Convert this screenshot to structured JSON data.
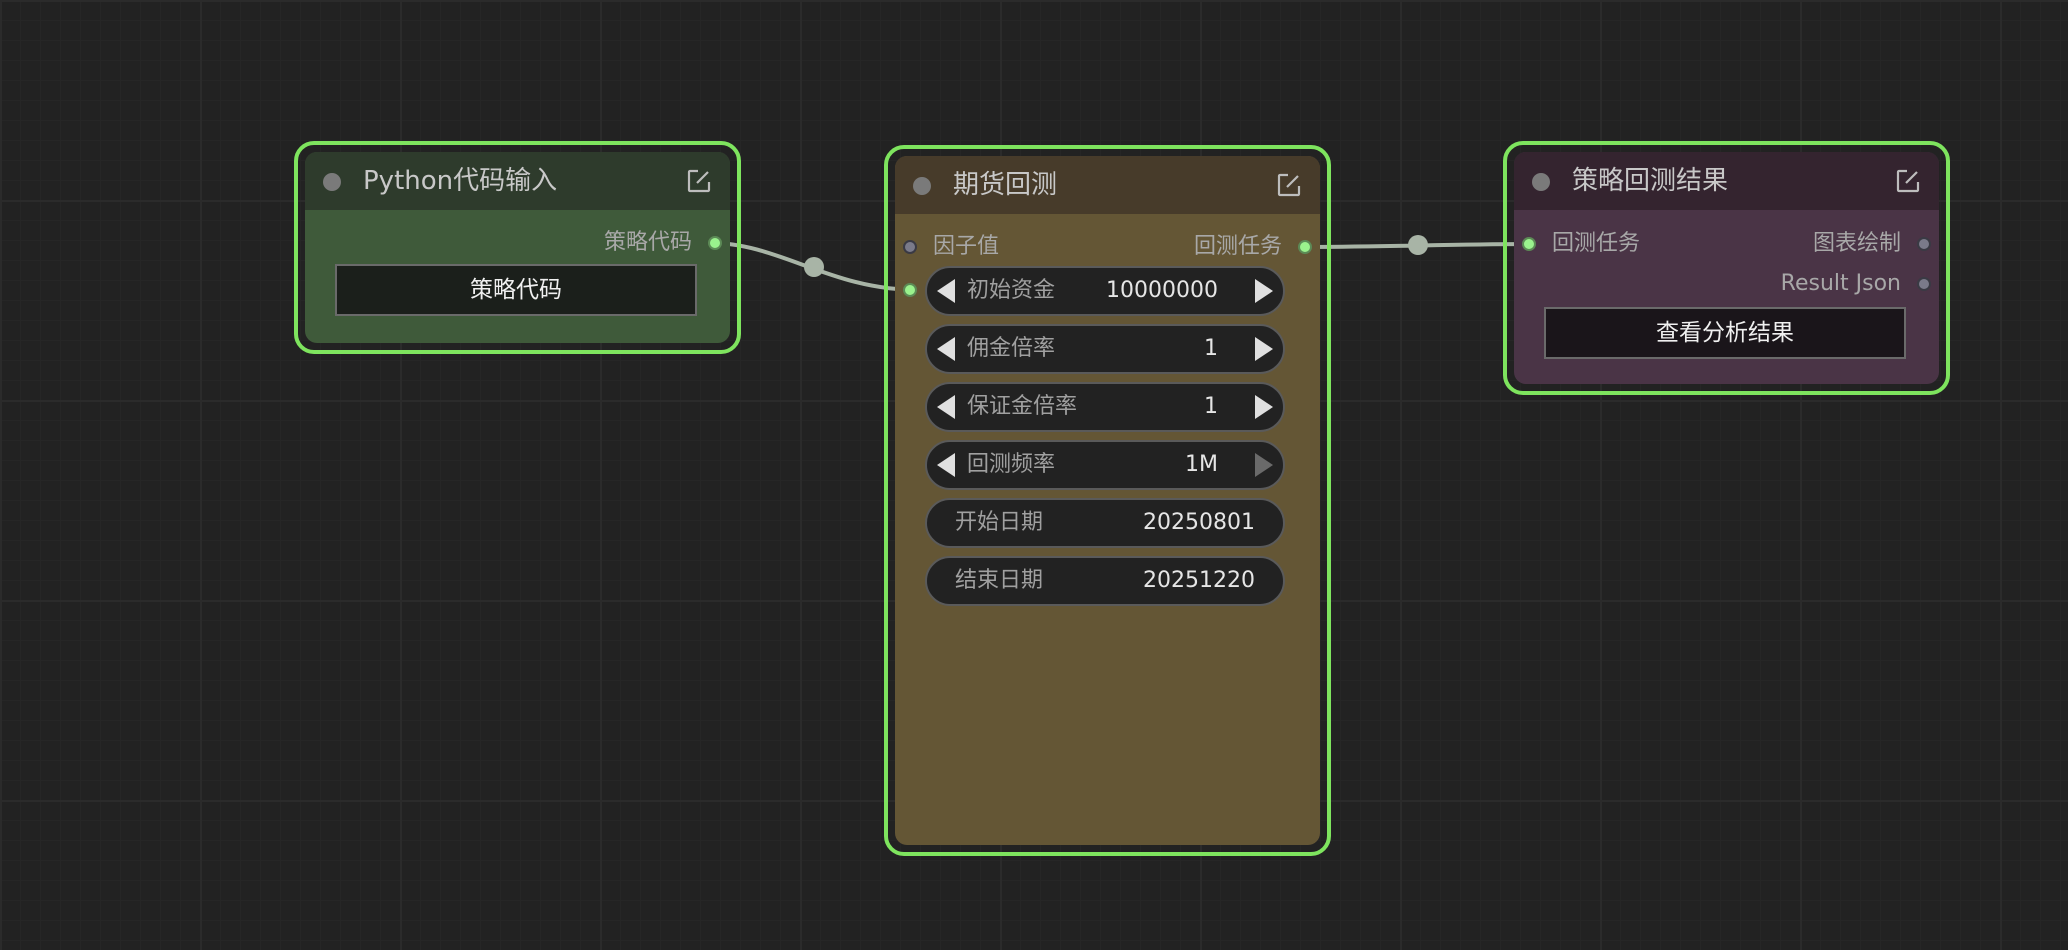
{
  "colors": {
    "canvas_bg": "#222222",
    "selected_outline": "#7ee45e",
    "link": "#a8b4a6",
    "python_node_title": "#2e3b2c",
    "python_node_body": "#3f5a3a",
    "backtest_node_title": "#473b2a",
    "backtest_node_body": "#645635",
    "result_node_title": "#34242f",
    "result_node_body": "#4a3446"
  },
  "nodes": {
    "python_input": {
      "title": "Python代码输入",
      "output_label": "策略代码",
      "button_label": "策略代码"
    },
    "futures_backtest": {
      "title": "期货回测",
      "input_label": "因子值",
      "output_label": "回测任务",
      "widgets": [
        {
          "label": "初始资金",
          "value": "10000000"
        },
        {
          "label": "佣金倍率",
          "value": "1"
        },
        {
          "label": "保证金倍率",
          "value": "1"
        },
        {
          "label": "回测频率",
          "value": "1M"
        },
        {
          "label": "开始日期",
          "value": "20250801"
        },
        {
          "label": "结束日期",
          "value": "20251220"
        }
      ]
    },
    "strategy_result": {
      "title": "策略回测结果",
      "input_label": "回测任务",
      "output_chart_label": "图表绘制",
      "output_json_label": "Result Json",
      "button_label": "查看分析结果"
    }
  },
  "icons": {
    "node_collapse": "circle-dot-icon",
    "node_edit": "edit-square-icon",
    "widget_decrement": "triangle-left-icon",
    "widget_increment": "triangle-right-icon"
  }
}
